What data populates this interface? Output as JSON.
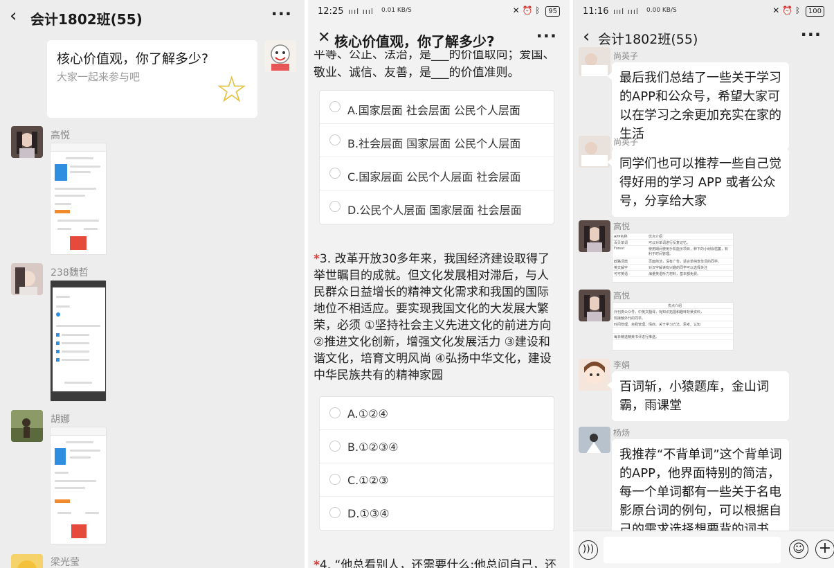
{
  "panel1": {
    "header": {
      "back_icon": "chevron-left-icon",
      "title": "会计1802班(55)",
      "more_icon": "more-dots-icon"
    },
    "link_card": {
      "title": "核心价值观，你了解多少?",
      "subtitle": "大家一起来参与吧",
      "star_icon": "star-icon"
    },
    "senders": [
      "高悦",
      "238魏哲",
      "胡娜",
      "梁光莹"
    ]
  },
  "panel2": {
    "status": {
      "time": "12:25",
      "signal": "ıııl ıııl",
      "speed": "0.01 KB/S",
      "battery": "95"
    },
    "header": {
      "close_icon": "close-icon",
      "title": "核心价值观，你了解多少?",
      "more_icon": "more-dots-icon"
    },
    "partial_question": "平等、公正、法治，是___的价值取向；爱国、敬业、诚信、友善，是___的价值准则。",
    "q2_options": [
      "A.国家层面 社会层面 公民个人层面",
      "B.社会层面 国家层面 公民个人层面",
      "C.国家层面 公民个人层面 社会层面",
      "D.公民个人层面 国家层面 社会层面"
    ],
    "q3": {
      "required_mark": "*",
      "text": "3. 改革开放30多年来，我国经济建设取得了举世瞩目的成就。但文化发展相对滞后，与人民群众日益增长的精神文化需求和我国的国际地位不相适应。要实现我国文化的大发展大繁荣，必须 ①坚持社会主义先进文化的前进方向 ②推进文化创新，增强文化发展活力 ③建设和谐文化，培育文明风尚 ④弘扬中华文化，建设中华民族共有的精神家园",
      "options": [
        "A.①②④",
        "B.①②③④",
        "C.①②③",
        "D.①③④"
      ]
    },
    "q4_partial": "4. “他总看别人，还需要什么;他总问自己，还"
  },
  "panel3": {
    "status": {
      "time": "11:16",
      "signal": "ıııl ıııl",
      "speed": "0.00 KB/S",
      "battery": "100"
    },
    "header": {
      "back_icon": "chevron-left-icon",
      "title": "会计1802班(55)",
      "more_icon": "more-dots-icon"
    },
    "messages": [
      {
        "sender": "尚英子",
        "text": "最后我们总结了一些关于学习的APP和公众号，希望大家可以在学习之余更加充实在家的生活"
      },
      {
        "sender": "尚英子",
        "text": "同学们也可以推荐一些自己觉得好用的学习 APP 或者公众号，分享给大家"
      },
      {
        "sender": "高悦",
        "image": "app-table-image"
      },
      {
        "sender": "高悦",
        "image": "wechat-account-table-image"
      },
      {
        "sender": "李娟",
        "text": "百词斩，小猿题库，金山词霸，雨课堂"
      },
      {
        "sender": "杨炀",
        "text": "我推荐“不背单词”这个背单词的APP，他界面特别的简洁，每一个单词都有一些关于名电影原台词的例句，可以根据自己的需求选择想要背的词书，特别的方"
      }
    ],
    "table1": {
      "rows": [
        [
          "APP名称",
          "优点介绍"
        ],
        [
          "百贝单词",
          "可以对单词进行反复记忆。"
        ],
        [
          "Forest",
          "使用期间使用手机能示项目，种下的小树会枯萎，有利于时间管理。"
        ],
        [
          "欧路词典",
          "页面简洁，没有广告，适合单纯查单词的同学。"
        ],
        [
          "英文解字",
          "对汉字解读有兴趣的同学可以选择关注"
        ],
        [
          "可可英语",
          "海量英语听力材料，基本都免费。"
        ]
      ]
    },
    "table2": {
      "rows": [
        [
          "",
          "优点介绍"
        ],
        [
          "外刊类公众号，中英文翻译，有知识拓展和趣味背景资料，",
          ""
        ],
        [
          "则接触外刊的同学。",
          ""
        ],
        [
          "时间管理、自我管理、情商、关于学习方法、思考、认知",
          ""
        ],
        [
          "",
          ""
        ],
        [
          "每日精选精美书评进行推送。",
          ""
        ]
      ]
    },
    "input_bar": {
      "voice_icon": "voice-icon",
      "emoji_icon": "emoji-icon",
      "plus_icon": "plus-icon"
    }
  }
}
